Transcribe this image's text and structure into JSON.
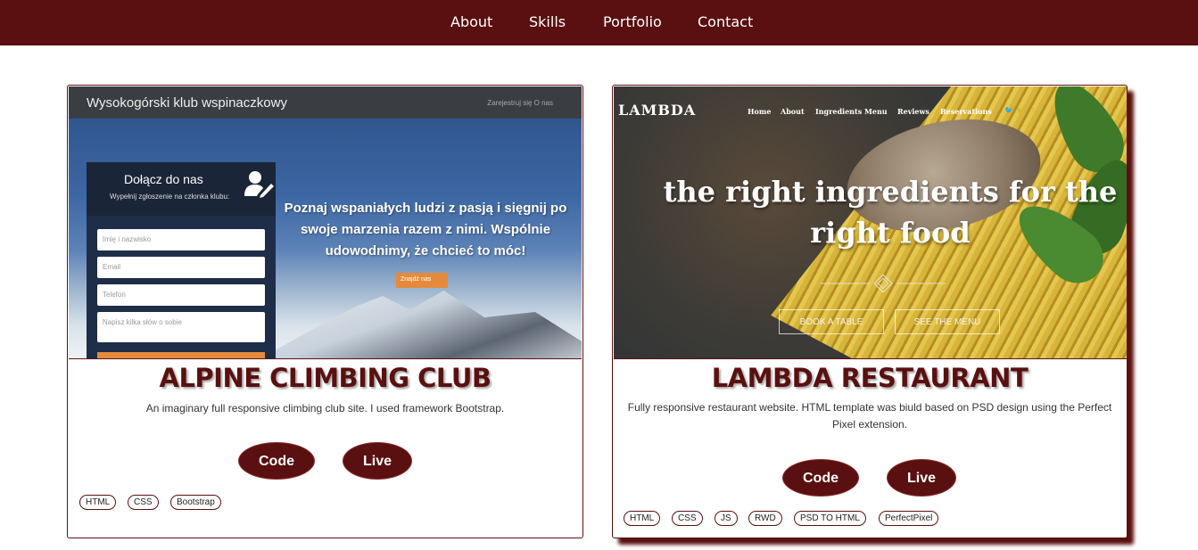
{
  "nav": {
    "items": [
      {
        "label": "About"
      },
      {
        "label": "Skills"
      },
      {
        "label": "Portfolio"
      },
      {
        "label": "Contact"
      }
    ]
  },
  "projects": [
    {
      "title": "ALPINE CLIMBING CLUB",
      "description": "An imaginary full responsive climbing club site. I used framework Bootstrap.",
      "code_label": "Code",
      "live_label": "Live",
      "tags": [
        "HTML",
        "CSS",
        "Bootstrap"
      ],
      "thumbnail": {
        "brand": "Wysokogórski klub wspinaczkowy",
        "links": "Zarejestruj się    O nas",
        "form_title": "Dołącz do nas",
        "form_subtitle": "Wypełnij zgłoszenie na członka klubu:",
        "fields": [
          "Imię i nazwisko",
          "Email",
          "Telefon",
          "Napisz kilka słów o sobie"
        ],
        "headline": "Poznaj wspaniałych ludzi z pasją i sięgnij po swoje marzenia razem z nimi. Wspólnie udowodnimy, że chcieć to móc!",
        "cta": "Znajdź nas"
      }
    },
    {
      "title": "LAMBDA RESTAURANT",
      "description": "Fully responsive restaurant website. HTML template was biuld based on PSD design using the Perfect Pixel extension.",
      "code_label": "Code",
      "live_label": "Live",
      "tags": [
        "HTML",
        "CSS",
        "JS",
        "RWD",
        "PSD TO HTML",
        "PerfectPixel"
      ],
      "thumbnail": {
        "logo": "LAMBDA",
        "nav": [
          "Home",
          "About",
          "Ingredients",
          "Menu",
          "Reviews",
          "Reservations"
        ],
        "headline": "the right ingredients for the right food",
        "btn_table": "BOOK A TABLE",
        "btn_menu": "SEE THE MENU"
      }
    }
  ],
  "colors": {
    "brand": "#5a1010",
    "accent": "#e58a3c",
    "gold": "#d7b43a"
  }
}
